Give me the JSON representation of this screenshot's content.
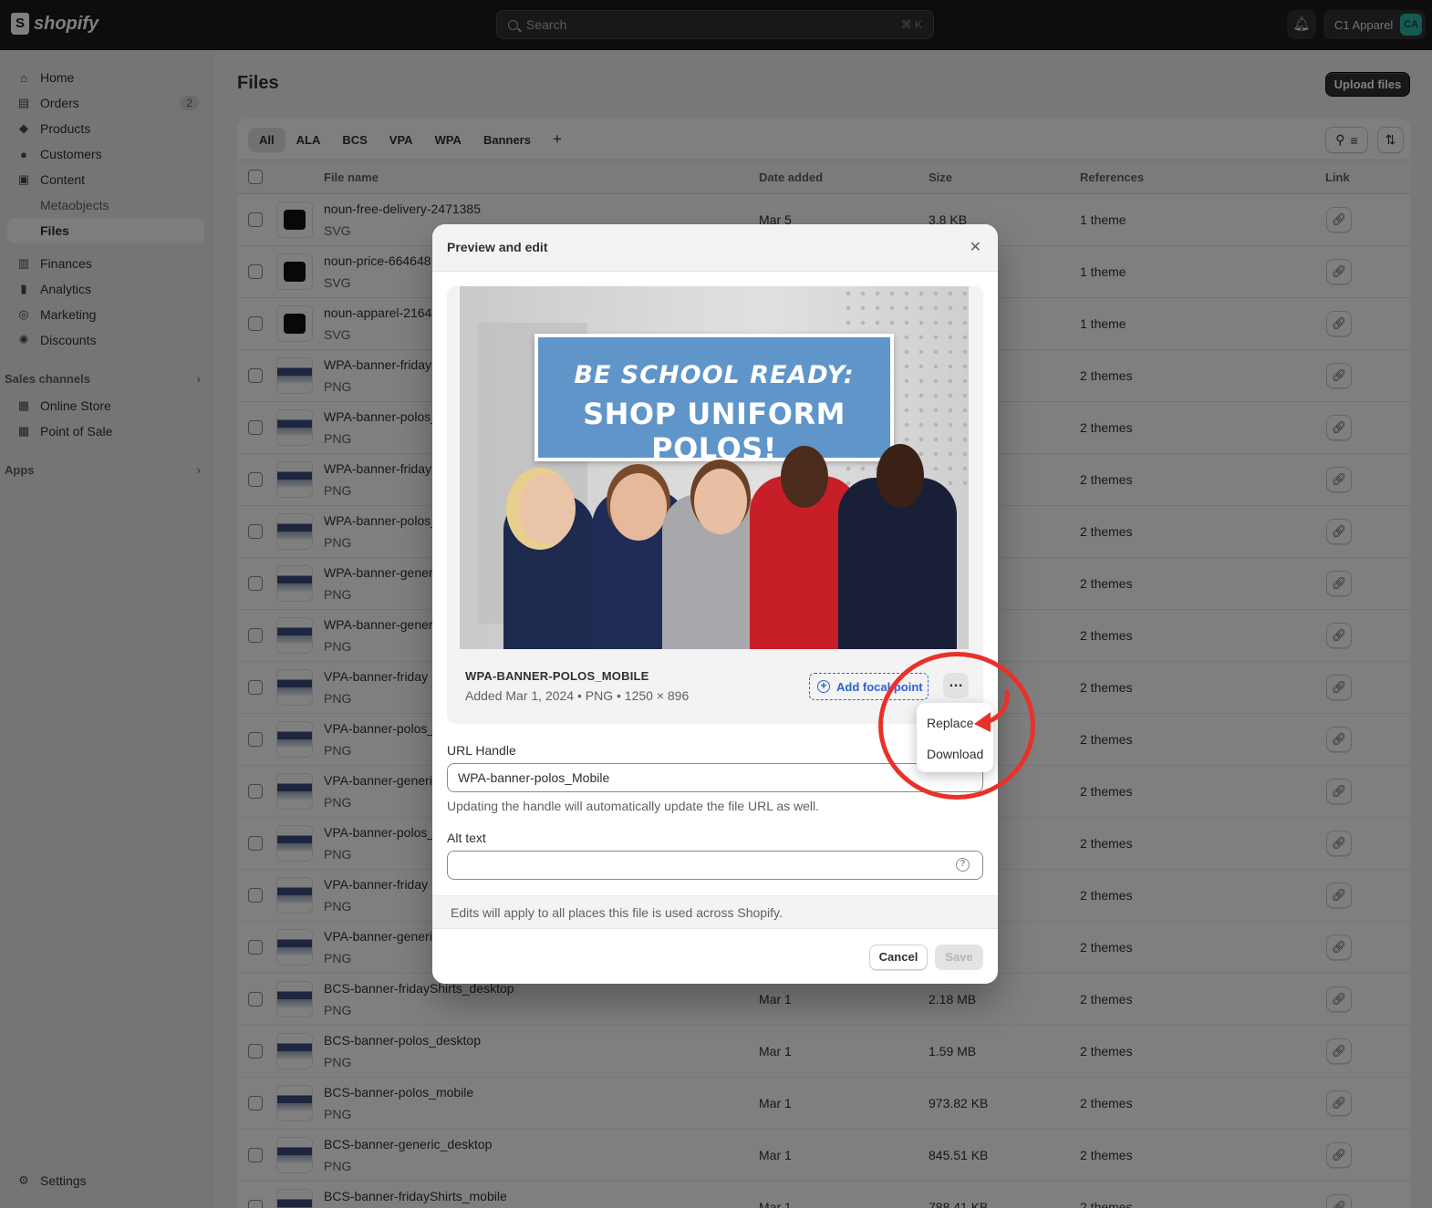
{
  "topbar": {
    "brand": "shopify",
    "search_placeholder": "Search",
    "search_shortcut": "⌘ K",
    "store_name": "C1 Apparel",
    "store_initials": "CA"
  },
  "sidebar": {
    "items": [
      {
        "label": "Home",
        "icon": "home-icon"
      },
      {
        "label": "Orders",
        "icon": "orders-icon",
        "badge": "2"
      },
      {
        "label": "Products",
        "icon": "tag-icon"
      },
      {
        "label": "Customers",
        "icon": "person-icon"
      },
      {
        "label": "Content",
        "icon": "content-icon"
      },
      {
        "label": "Metaobjects"
      },
      {
        "label": "Files"
      },
      {
        "label": "Finances",
        "icon": "bank-icon"
      },
      {
        "label": "Analytics",
        "icon": "bar-chart-icon"
      },
      {
        "label": "Marketing",
        "icon": "target-icon"
      },
      {
        "label": "Discounts",
        "icon": "discount-icon"
      }
    ],
    "sales_channels_label": "Sales channels",
    "channels": [
      {
        "label": "Online Store",
        "icon": "store-icon"
      },
      {
        "label": "Point of Sale",
        "icon": "pos-icon"
      }
    ],
    "apps_label": "Apps",
    "settings_label": "Settings"
  },
  "page": {
    "title": "Files",
    "upload_label": "Upload files"
  },
  "tabs": [
    "All",
    "ALA",
    "BCS",
    "VPA",
    "WPA",
    "Banners",
    "+"
  ],
  "table": {
    "headers": {
      "file_name": "File name",
      "date_added": "Date added",
      "size": "Size",
      "references": "References",
      "link": "Link"
    },
    "rows": [
      {
        "name": "noun-free-delivery-2471385",
        "type": "SVG",
        "date": "Mar 5",
        "size": "3.8 KB",
        "refs": "1 theme",
        "thumb": "svg"
      },
      {
        "name": "noun-price-664648",
        "type": "SVG",
        "date": "",
        "size": "",
        "refs": "1 theme",
        "thumb": "svg"
      },
      {
        "name": "noun-apparel-2164",
        "type": "SVG",
        "date": "",
        "size": "",
        "refs": "1 theme",
        "thumb": "svg"
      },
      {
        "name": "WPA-banner-friday",
        "type": "PNG",
        "date": "",
        "size": "",
        "refs": "2 themes",
        "thumb": "png"
      },
      {
        "name": "WPA-banner-polos_",
        "type": "PNG",
        "date": "",
        "size": "",
        "refs": "2 themes",
        "thumb": "png"
      },
      {
        "name": "WPA-banner-friday",
        "type": "PNG",
        "date": "",
        "size": "",
        "refs": "2 themes",
        "thumb": "png"
      },
      {
        "name": "WPA-banner-polos_",
        "type": "PNG",
        "date": "",
        "size": "",
        "refs": "2 themes",
        "thumb": "png"
      },
      {
        "name": "WPA-banner-gener",
        "type": "PNG",
        "date": "",
        "size": "",
        "refs": "2 themes",
        "thumb": "png"
      },
      {
        "name": "WPA-banner-gener",
        "type": "PNG",
        "date": "",
        "size": "",
        "refs": "2 themes",
        "thumb": "png"
      },
      {
        "name": "VPA-banner-friday",
        "type": "PNG",
        "date": "",
        "size": "",
        "refs": "2 themes",
        "thumb": "png"
      },
      {
        "name": "VPA-banner-polos_",
        "type": "PNG",
        "date": "",
        "size": "",
        "refs": "2 themes",
        "thumb": "png"
      },
      {
        "name": "VPA-banner-generi",
        "type": "PNG",
        "date": "",
        "size": "",
        "refs": "2 themes",
        "thumb": "png"
      },
      {
        "name": "VPA-banner-polos_",
        "type": "PNG",
        "date": "",
        "size": "",
        "refs": "2 themes",
        "thumb": "png"
      },
      {
        "name": "VPA-banner-friday",
        "type": "PNG",
        "date": "",
        "size": "",
        "refs": "2 themes",
        "thumb": "png"
      },
      {
        "name": "VPA-banner-generi",
        "type": "PNG",
        "date": "",
        "size": "",
        "refs": "2 themes",
        "thumb": "png"
      },
      {
        "name": "BCS-banner-fridayShirts_desktop",
        "type": "PNG",
        "date": "Mar 1",
        "size": "2.18 MB",
        "refs": "2 themes",
        "thumb": "png"
      },
      {
        "name": "BCS-banner-polos_desktop",
        "type": "PNG",
        "date": "Mar 1",
        "size": "1.59 MB",
        "refs": "2 themes",
        "thumb": "png"
      },
      {
        "name": "BCS-banner-polos_mobile",
        "type": "PNG",
        "date": "Mar 1",
        "size": "973.82 KB",
        "refs": "2 themes",
        "thumb": "png"
      },
      {
        "name": "BCS-banner-generic_desktop",
        "type": "PNG",
        "date": "Mar 1",
        "size": "845.51 KB",
        "refs": "2 themes",
        "thumb": "png"
      },
      {
        "name": "BCS-banner-fridayShirts_mobile",
        "type": "",
        "date": "Mar 1",
        "size": "788.41 KB",
        "refs": "2 themes",
        "thumb": "png"
      }
    ]
  },
  "modal": {
    "title": "Preview and edit",
    "banner_line1": "BE SCHOOL READY:",
    "banner_line2": "SHOP UNIFORM POLOS!",
    "file_title": "WPA-BANNER-POLOS_MOBILE",
    "file_meta": "Added Mar 1, 2024 • PNG • 1250 × 896",
    "focal_label": "Add focal point",
    "url_label": "URL Handle",
    "url_value": "WPA-banner-polos_Mobile",
    "url_help": "Updating the handle will automatically update the file URL as well.",
    "alt_label": "Alt text",
    "alt_value": "",
    "notice": "Edits will apply to all places this file is used across Shopify.",
    "cancel_label": "Cancel",
    "save_label": "Save"
  },
  "popover": {
    "items": [
      "Replace",
      "Download"
    ]
  },
  "colors": {
    "annotation": "#e8312a",
    "accent_blue": "#2b62d9",
    "topbar": "#1a1a1a"
  }
}
